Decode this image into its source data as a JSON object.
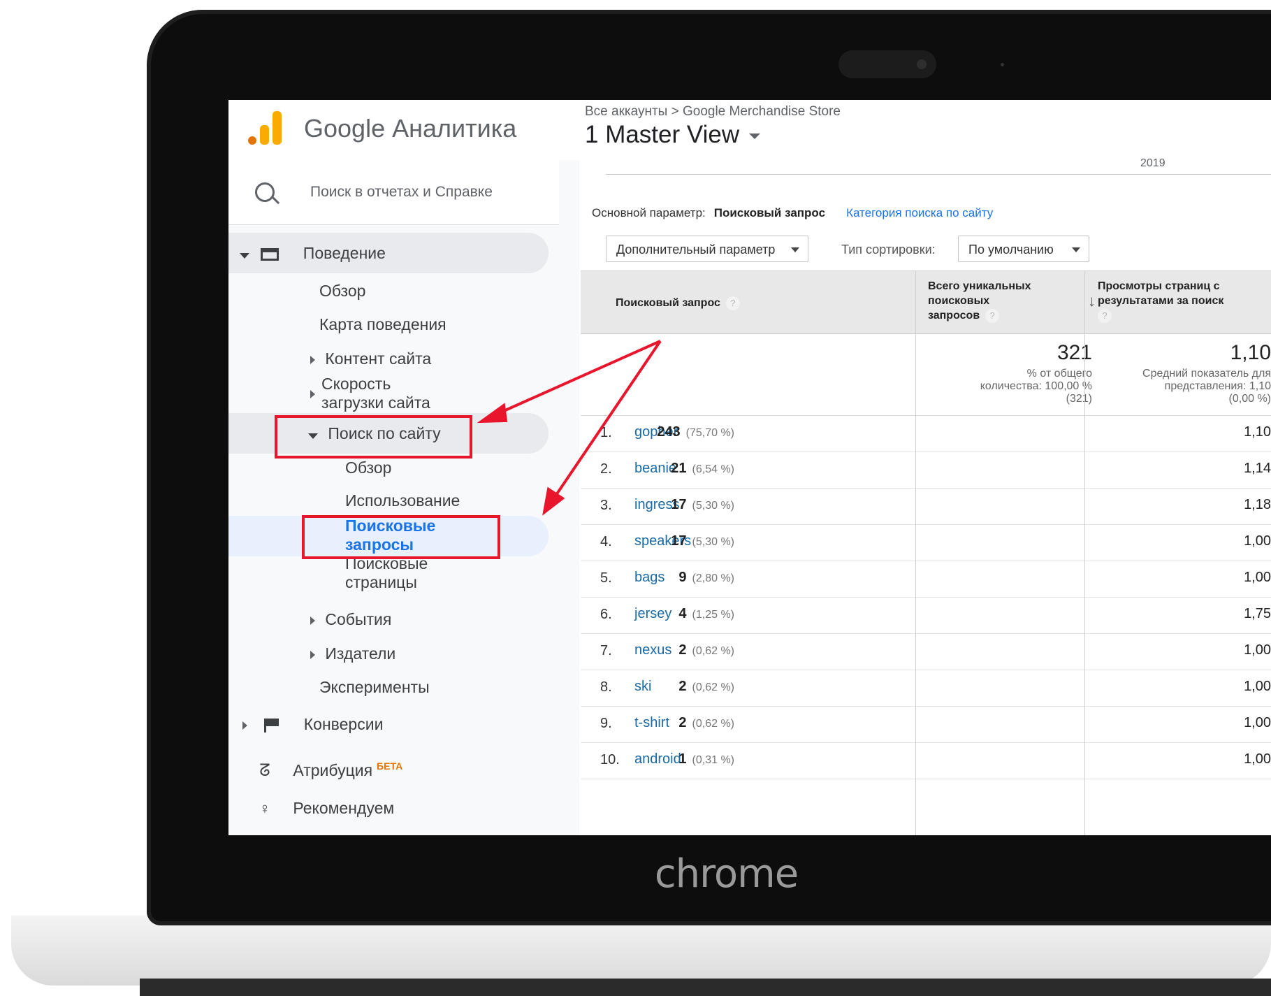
{
  "device": {
    "bezel_label": "chrome"
  },
  "app": {
    "brand": "Google Аналитика"
  },
  "search": {
    "placeholder": "Поиск в отчетах и Справке"
  },
  "sidebar": {
    "behavior": "Поведение",
    "overview": "Обзор",
    "behavior_flow": "Карта поведения",
    "site_content": "Контент сайта",
    "site_speed_1": "Скорость",
    "site_speed_2": "загрузки сайта",
    "site_search": "Поиск по сайту",
    "ss_overview": "Обзор",
    "ss_usage": "Использование",
    "ss_terms_1": "Поисковые",
    "ss_terms_2": "запросы",
    "ss_pages_1": "Поисковые",
    "ss_pages_2": "страницы",
    "events": "События",
    "publisher": "Издатели",
    "experiments": "Эксперименты",
    "conversions": "Конверсии",
    "attribution": "Атрибуция",
    "beta": "БЕТА",
    "discover": "Рекомендуем"
  },
  "header": {
    "breadcrumb": "Все аккаунты > Google Merchandise Store",
    "view": "1 Master View",
    "year": "2019"
  },
  "params": {
    "primary_label": "Основной параметр:",
    "primary_value": "Поисковый запрос",
    "alt_link": "Категория поиска по сайту",
    "secondary": "Дополнительный параметр",
    "sort_label": "Тип сортировки:",
    "sort_value": "По умолчанию"
  },
  "table": {
    "col1": "Поисковый запрос",
    "col2_1": "Всего уникальных",
    "col2_2": "поисковых",
    "col2_3": "запросов",
    "col3_1": "Просмотры страниц с",
    "col3_2": "результатами за поиск",
    "qmark": "?",
    "total_unique": "321",
    "total_sub_1": "% от общего",
    "total_sub_2": "количества: 100,00 %",
    "total_sub_3": "(321)",
    "total_views": "1,10",
    "views_sub_1": "Средний показатель для",
    "views_sub_2": "представления: 1,10",
    "views_sub_3": "(0,00 %)",
    "rows": [
      {
        "idx": "1.",
        "term": "gopher",
        "count": "243",
        "pct": "(75,70 %)",
        "views": "1,10"
      },
      {
        "idx": "2.",
        "term": "beanie",
        "count": "21",
        "pct": "(6,54 %)",
        "views": "1,14"
      },
      {
        "idx": "3.",
        "term": "ingress",
        "count": "17",
        "pct": "(5,30 %)",
        "views": "1,18"
      },
      {
        "idx": "4.",
        "term": "speakers",
        "count": "17",
        "pct": "(5,30 %)",
        "views": "1,00"
      },
      {
        "idx": "5.",
        "term": "bags",
        "count": "9",
        "pct": "(2,80 %)",
        "views": "1,00"
      },
      {
        "idx": "6.",
        "term": "jersey",
        "count": "4",
        "pct": "(1,25 %)",
        "views": "1,75"
      },
      {
        "idx": "7.",
        "term": "nexus",
        "count": "2",
        "pct": "(0,62 %)",
        "views": "1,00"
      },
      {
        "idx": "8.",
        "term": "ski",
        "count": "2",
        "pct": "(0,62 %)",
        "views": "1,00"
      },
      {
        "idx": "9.",
        "term": "t-shirt",
        "count": "2",
        "pct": "(0,62 %)",
        "views": "1,00"
      },
      {
        "idx": "10.",
        "term": "android",
        "count": "1",
        "pct": "(0,31 %)",
        "views": "1,00"
      }
    ]
  },
  "colors": {
    "annotation": "#e8162d",
    "accent": "#1a73e8",
    "logo_orange": "#f9ab00",
    "logo_dark": "#e37400"
  }
}
